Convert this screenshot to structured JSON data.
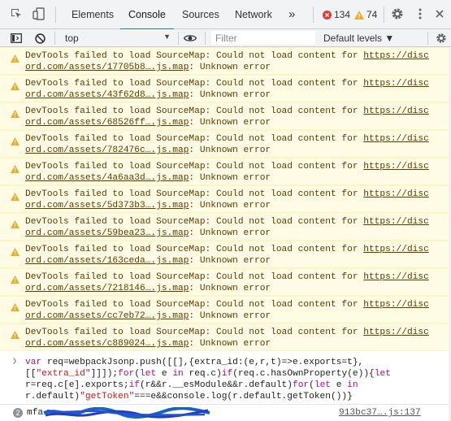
{
  "tabs": [
    {
      "label": "Elements",
      "selected": false
    },
    {
      "label": "Console",
      "selected": true
    },
    {
      "label": "Sources",
      "selected": false
    },
    {
      "label": "Network",
      "selected": false
    }
  ],
  "more_tabs_label": "»",
  "errors_count": "134",
  "warnings_count": "74",
  "context": {
    "value": "top"
  },
  "filter": {
    "placeholder": "Filter",
    "value": ""
  },
  "levels_label": "Default levels ▼",
  "warnings": [
    {
      "prefix": "DevTools failed to load SourceMap: Could not load content for ",
      "url1": "https://disc",
      "url2": "ord.com/assets/17705b8….js.map",
      "suffix": ": Unknown error"
    },
    {
      "prefix": "DevTools failed to load SourceMap: Could not load content for ",
      "url1": "https://disc",
      "url2": "ord.com/assets/43f62d8….js.map",
      "suffix": ": Unknown error"
    },
    {
      "prefix": "DevTools failed to load SourceMap: Could not load content for ",
      "url1": "https://disc",
      "url2": "ord.com/assets/68526ff….js.map",
      "suffix": ": Unknown error"
    },
    {
      "prefix": "DevTools failed to load SourceMap: Could not load content for ",
      "url1": "https://disc",
      "url2": "ord.com/assets/782476c….js.map",
      "suffix": ": Unknown error"
    },
    {
      "prefix": "DevTools failed to load SourceMap: Could not load content for ",
      "url1": "https://disc",
      "url2": "ord.com/assets/4a6aa3d….js.map",
      "suffix": ": Unknown error"
    },
    {
      "prefix": "DevTools failed to load SourceMap: Could not load content for ",
      "url1": "https://disc",
      "url2": "ord.com/assets/5d373b3….js.map",
      "suffix": ": Unknown error"
    },
    {
      "prefix": "DevTools failed to load SourceMap: Could not load content for ",
      "url1": "https://disc",
      "url2": "ord.com/assets/59bea23….js.map",
      "suffix": ": Unknown error"
    },
    {
      "prefix": "DevTools failed to load SourceMap: Could not load content for ",
      "url1": "https://disc",
      "url2": "ord.com/assets/163ceda….js.map",
      "suffix": ": Unknown error"
    },
    {
      "prefix": "DevTools failed to load SourceMap: Could not load content for ",
      "url1": "https://disc",
      "url2": "ord.com/assets/7218146….js.map",
      "suffix": ": Unknown error"
    },
    {
      "prefix": "DevTools failed to load SourceMap: Could not load content for ",
      "url1": "https://disc",
      "url2": "ord.com/assets/cc7eb72….js.map",
      "suffix": ": Unknown error"
    },
    {
      "prefix": "DevTools failed to load SourceMap: Could not load content for ",
      "url1": "https://disc",
      "url2": "ord.com/assets/c889024….js.map",
      "suffix": ": Unknown error"
    }
  ],
  "command": {
    "line1a": "var ",
    "line1b": "req=webpackJsonp.push([[],{extra_id:(e,r,t)=>e.exports=t},",
    "line2a": "[[",
    "line2b": "\"extra_id\"",
    "line2c": "]]]);",
    "line2d": "for",
    "line2e": "(",
    "line2f": "let",
    "line2g": " e ",
    "line2h": "in",
    "line2i": " req.c)",
    "line2j": "if",
    "line2k": "(req.c.hasOwnProperty(e)){",
    "line2l": "let",
    "line3a": "r=req.c[e].exports;",
    "line3b": "if",
    "line3c": "(r&&r.__esModule&&r.default)",
    "line3d": "for",
    "line3e": "(",
    "line3f": "let",
    "line3g": " e ",
    "line3h": "in",
    "line4a": "r.default)",
    "line4b": "\"getToken\"",
    "line4c": "===e&&console.log(r.default.getToken())}"
  },
  "result": {
    "count": "2",
    "value_visible": "mfa",
    "source": "913bc37….js:137"
  },
  "colors": {
    "error": "#e53935",
    "warning": "#f2ab26",
    "accent": "#1a73e8",
    "warning_bg": "#fffbe5",
    "warning_text": "#5c3c00"
  }
}
